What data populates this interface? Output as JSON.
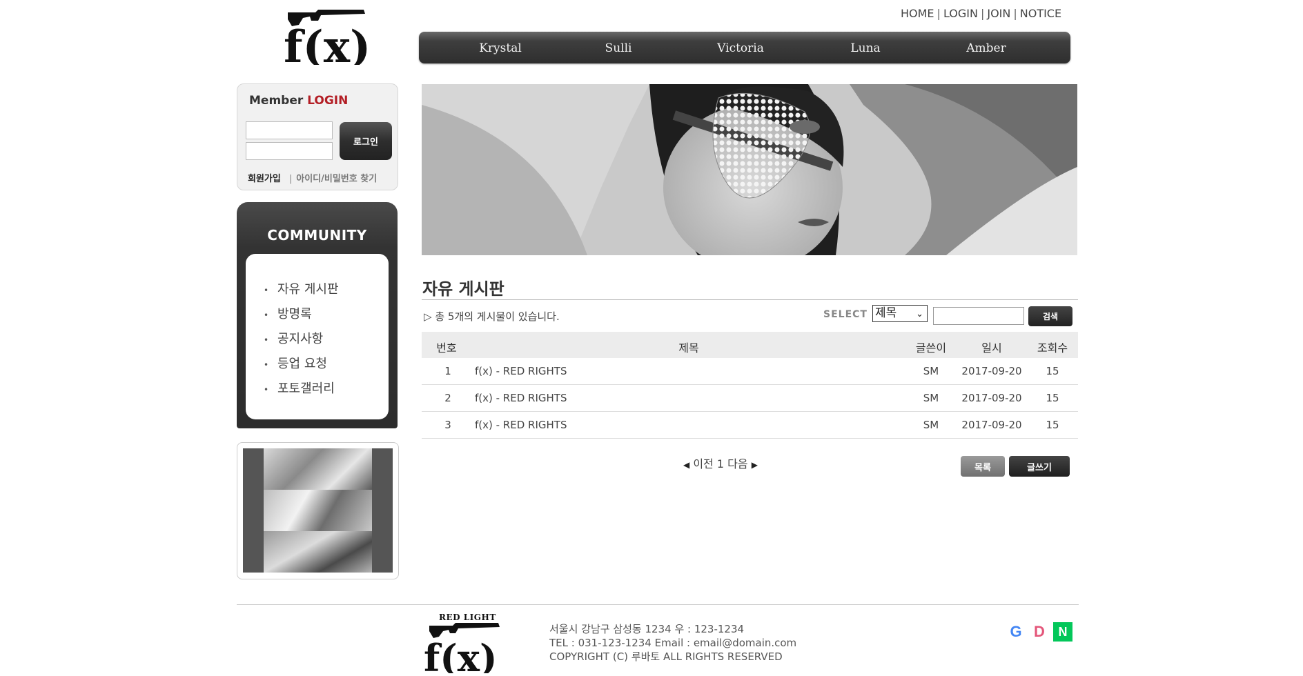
{
  "brand": {
    "logo_text": "f(x)",
    "footer_logo_tagline": "RED LIGHT"
  },
  "util_nav": [
    "HOME",
    "LOGIN",
    "JOIN",
    "NOTICE"
  ],
  "main_nav": [
    "Krystal",
    "Sulli",
    "Victoria",
    "Luna",
    "Amber"
  ],
  "login": {
    "title_prefix": "Member",
    "title_accent": "LOGIN",
    "button_label": "로그인",
    "join_label": "회원가입",
    "find_label": "아이디/비밀번호 찾기"
  },
  "community": {
    "title": "COMMUNITY",
    "items": [
      "자유 게시판",
      "방명록",
      "공지사항",
      "등업 요청",
      "포토갤러리"
    ]
  },
  "board": {
    "title": "자유 게시판",
    "count_text": "총 5개의 게시물이 있습니다.",
    "select_label": "SELECT",
    "select_value": "제목",
    "search_button": "검색",
    "columns": [
      "번호",
      "제목",
      "글쓴이",
      "일시",
      "조회수"
    ],
    "rows": [
      {
        "no": "1",
        "title": "f(x) - RED RIGHTS",
        "author": "SM",
        "date": "2017-09-20",
        "views": "15"
      },
      {
        "no": "2",
        "title": "f(x) - RED RIGHTS",
        "author": "SM",
        "date": "2017-09-20",
        "views": "15"
      },
      {
        "no": "3",
        "title": "f(x) - RED RIGHTS",
        "author": "SM",
        "date": "2017-09-20",
        "views": "15"
      }
    ],
    "pagination": {
      "prev": "이전",
      "current": "1",
      "next": "다음"
    },
    "list_button": "목록",
    "write_button": "글쓰기"
  },
  "footer": {
    "address": "서울시 강남구 삼성동 1234 우 : 123-1234",
    "contact": "TEL : 031-123-1234 Email : email@domain.com",
    "copyright": "COPYRIGHT (C) 루바토 ALL RIGHTS RESERVED",
    "social": [
      {
        "letter": "G",
        "icon": "google-icon",
        "color": "#4285F4"
      },
      {
        "letter": "D",
        "icon": "daum-icon",
        "color": "#E4567A"
      },
      {
        "letter": "N",
        "icon": "naver-icon",
        "color": "#03C75A"
      }
    ]
  },
  "colors": {
    "accent": "#b31e25",
    "nav_bg": "#2e2e2e"
  }
}
